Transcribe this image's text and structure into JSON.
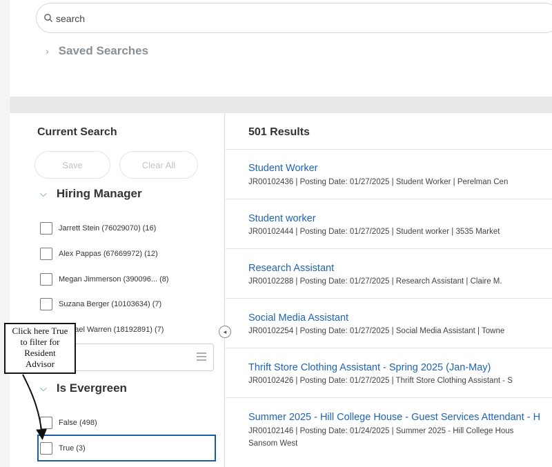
{
  "search": {
    "placeholder": "search"
  },
  "saved_searches": {
    "label": "Saved Searches"
  },
  "sidebar": {
    "title": "Current Search",
    "save_label": "Save",
    "clear_all_label": "Clear All",
    "hiring_manager": {
      "label": "Hiring Manager",
      "options": [
        "Jarrett Stein (76029070) (16)",
        "Alex Pappas (67669972) (12)",
        "Megan Jimmerson (390096...  (8)",
        "Suzana Berger (10103634) (7)",
        "Michael Warren (18192891) (7)"
      ]
    },
    "is_evergreen": {
      "label": "Is Evergreen",
      "options": [
        "False (498)",
        "True (3)"
      ]
    }
  },
  "results": {
    "count_label": "501 Results",
    "items": [
      {
        "title": "Student Worker",
        "meta": "JR00102436  |  Posting Date: 01/27/2025  |  Student Worker  |  Perelman Cen"
      },
      {
        "title": "Student worker",
        "meta": "JR00102444  |  Posting Date: 01/27/2025  |  Student worker  |  3535 Market"
      },
      {
        "title": "Research Assistant",
        "meta": "JR00102288  |  Posting Date: 01/27/2025  |  Research Assistant  |  Claire M."
      },
      {
        "title": "Social Media Assistant",
        "meta": "JR00102254  |  Posting Date: 01/27/2025  |  Social Media Assistant  |  Towne"
      },
      {
        "title": "Thrift Store Clothing Assistant - Spring 2025 (Jan-May)",
        "meta": "JR00102426  |  Posting Date: 01/27/2025  |  Thrift Store Clothing Assistant - S"
      },
      {
        "title": "Summer 2025 - Hill College House - Guest Services Attendant - H",
        "meta": "JR00102146  |  Posting Date: 01/24/2025  |  Summer 2025 - Hill College Hous",
        "extra": "Sansom West"
      }
    ]
  },
  "annotation": {
    "line1": "Click here True",
    "line2": "to filter for",
    "line3": "Resident",
    "line4": "Advisor"
  },
  "colors": {
    "link": "#1d63b7",
    "highlight": "#1c5aa8",
    "band": "#e9e9e9"
  }
}
